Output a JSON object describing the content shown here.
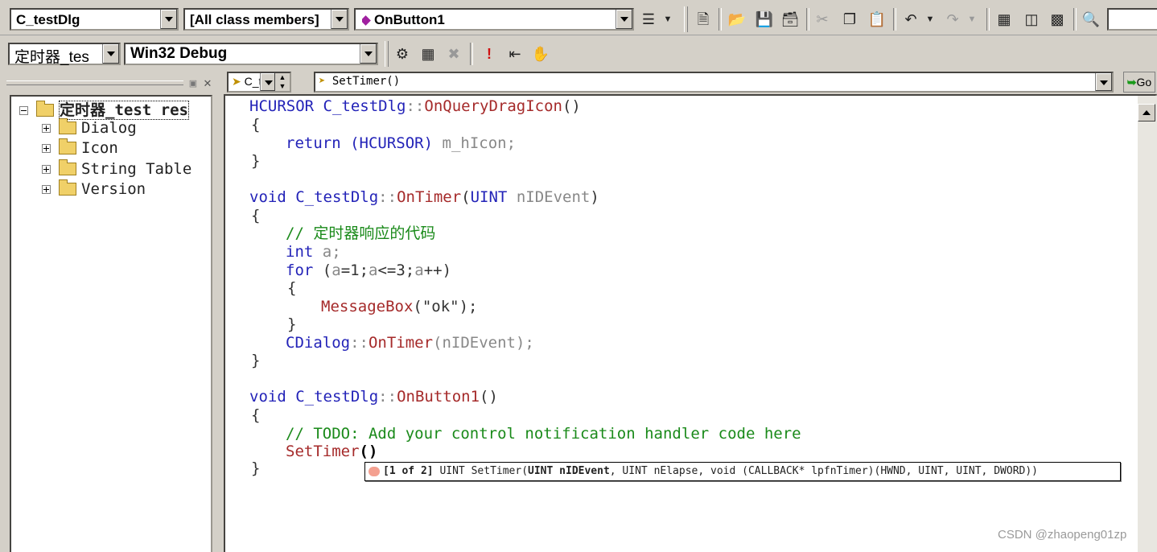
{
  "toolbar1": {
    "class_combo": "C_testDlg",
    "filter_combo": "[All class members]",
    "member_combo": "OnButton1",
    "member_icon": "purple-diamond-icon"
  },
  "toolbar2": {
    "project_combo": "定时器_tes",
    "config_combo": "Win32 Debug"
  },
  "editor_nav": {
    "class_short": "C_t",
    "function_combo": "SetTimer()",
    "go_label": "Go"
  },
  "tree": {
    "root": "定时器_test res",
    "items": [
      {
        "label": "Dialog"
      },
      {
        "label": "Icon"
      },
      {
        "label": "String Table"
      },
      {
        "label": "Version"
      }
    ]
  },
  "code": {
    "l1_type": "HCURSOR",
    "l1_class": "C_testDlg",
    "l1_sep": "::",
    "l1_func": "OnQueryDragIcon",
    "l1_paren": "()",
    "open": "{",
    "close": "}",
    "l3_return": "return",
    "l3_cast": "(HCURSOR)",
    "l3_var": "m_hIcon;",
    "l5_void": "void",
    "l5_class": "C_testDlg",
    "l5_sep": "::",
    "l5_func": "OnTimer",
    "l5_open": "(",
    "l5_type": "UINT",
    "l5_param": "nIDEvent",
    "l5_close": ")",
    "l7_comment": "// 定时器响应的代码",
    "l8_int": "int",
    "l8_var": "a;",
    "l9_for": "for",
    "l9_open": "(",
    "l9_a1": "a",
    "l9_p1": "=1;",
    "l9_a2": "a",
    "l9_p2": "<=3;",
    "l9_a3": "a",
    "l9_p3": "++)",
    "l11_func": "MessageBox",
    "l11_args": "(\"ok\");",
    "l13_class": "CDialog",
    "l13_sep": "::",
    "l13_func": "OnTimer",
    "l13_args": "(nIDEvent);",
    "l16_void": "void",
    "l16_class": "C_testDlg",
    "l16_sep": "::",
    "l16_func": "OnButton1",
    "l16_paren": "()",
    "l18_comment": "// TODO: Add your control notification handler code here",
    "l19_func": "SetTimer",
    "l19_paren": "()"
  },
  "tooltip": {
    "counter": "[1 of 2]",
    "pre": "UINT SetTimer(",
    "bold": "UINT nIDEvent",
    "post": ", UINT nElapse, void (CALLBACK* lpfnTimer)(HWND, UINT, UINT, DWORD))"
  },
  "watermark": "CSDN @zhaopeng01zp"
}
